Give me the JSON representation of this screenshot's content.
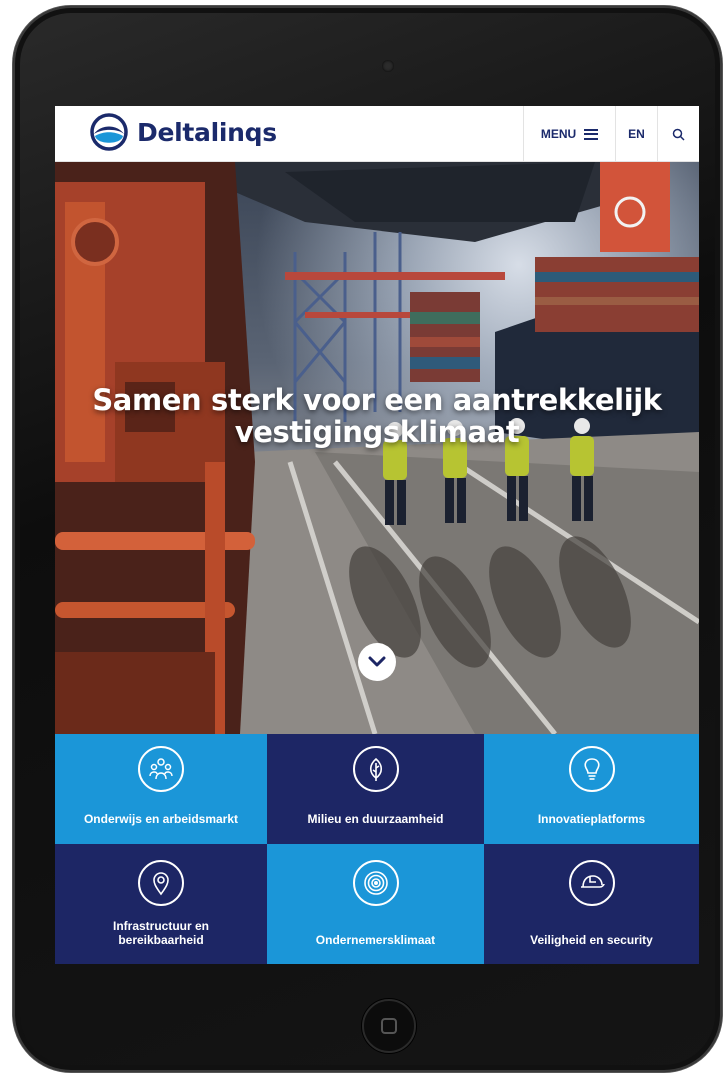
{
  "brand": {
    "name": "Deltalinqs",
    "primary": "#1b2a6b",
    "tile_light": "#1b96d8",
    "tile_dark": "#1d2665"
  },
  "header": {
    "menu_label": "MENU",
    "lang_label": "EN"
  },
  "hero": {
    "title_line1": "Samen sterk voor een aantrekkelijk",
    "title_line2": "vestigingsklimaat"
  },
  "tiles": [
    {
      "label": "Onderwijs en arbeidsmarkt",
      "icon": "people-icon"
    },
    {
      "label": "Milieu en duurzaamheid",
      "icon": "leaf-icon"
    },
    {
      "label": "Innovatieplatforms",
      "icon": "lightbulb-icon"
    },
    {
      "label": "Infrastructuur en bereikbaarheid",
      "line1": "Infrastructuur en",
      "line2": "bereikbaarheid",
      "icon": "location-pin-icon"
    },
    {
      "label": "Ondernemersklimaat",
      "icon": "target-icon"
    },
    {
      "label": "Veiligheid en security",
      "icon": "helmet-icon"
    }
  ]
}
